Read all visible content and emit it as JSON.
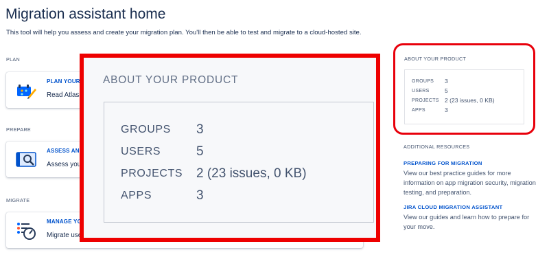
{
  "page": {
    "title": "Migration assistant home",
    "subtitle": "This tool will help you assess and create your migration plan. You'll then be able to test and migrate to a cloud-hosted site."
  },
  "sections": [
    {
      "label": "PLAN",
      "card": {
        "title": "PLAN YOUR",
        "description": "Read Atlass",
        "icon": "plan-icon"
      }
    },
    {
      "label": "PREPARE",
      "card": {
        "title": "ASSESS AND",
        "description": "Assess your",
        "icon": "assess-icon"
      }
    },
    {
      "label": "MIGRATE",
      "card": {
        "title": "MANAGE YO",
        "description": "Migrate use",
        "icon": "manage-icon"
      }
    }
  ],
  "about_product": {
    "heading": "ABOUT YOUR PRODUCT",
    "stats": [
      {
        "label": "GROUPS",
        "value": "3"
      },
      {
        "label": "USERS",
        "value": "5"
      },
      {
        "label": "PROJECTS",
        "value": "2 (23 issues, 0 KB)"
      },
      {
        "label": "APPS",
        "value": "3"
      }
    ]
  },
  "additional_resources": {
    "heading": "ADDITIONAL RESOURCES",
    "items": [
      {
        "link": "PREPARING FOR MIGRATION",
        "description": "View our best practice guides for more information on app migration security, migration testing, and preparation."
      },
      {
        "link": "JIRA CLOUD MIGRATION ASSISTANT",
        "description": "View our guides and learn how to prepare for your move."
      }
    ]
  },
  "colors": {
    "link": "#0052cc",
    "text": "#172b4d",
    "subtle": "#44546f",
    "highlight_red": "#ee0000"
  }
}
